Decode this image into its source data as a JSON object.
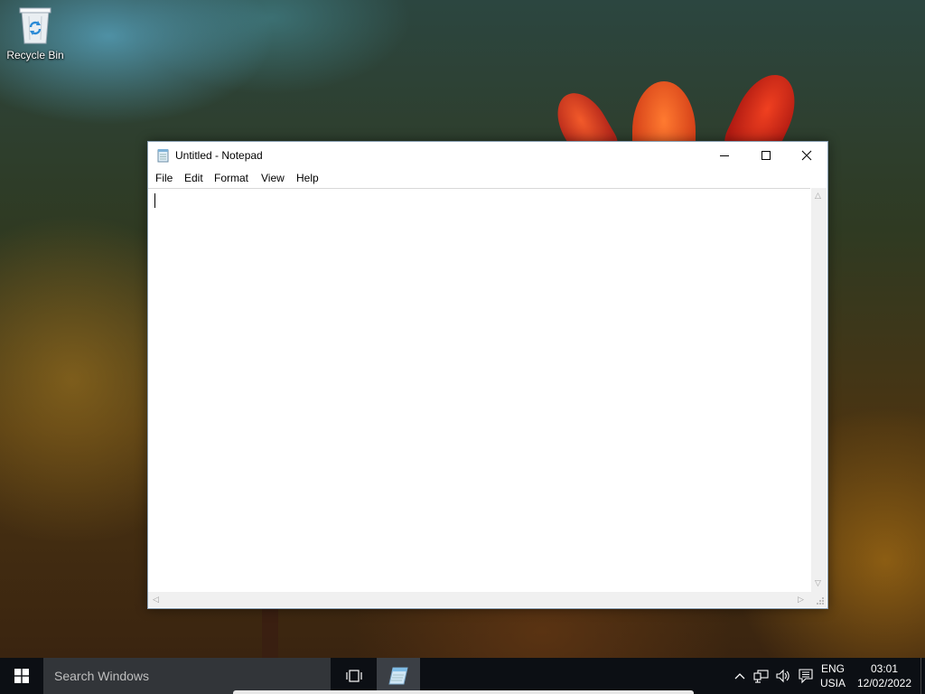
{
  "desktop": {
    "icons": [
      {
        "label": "Recycle Bin",
        "icon": "recycle-bin-icon"
      }
    ]
  },
  "window": {
    "title": "Untitled - Notepad",
    "app_icon": "notepad-icon",
    "controls": {
      "minimize": "minimize-icon",
      "maximize": "maximize-icon",
      "close": "close-icon"
    },
    "menu": [
      {
        "label": "File"
      },
      {
        "label": "Edit"
      },
      {
        "label": "Format"
      },
      {
        "label": "View"
      },
      {
        "label": "Help"
      }
    ],
    "content": ""
  },
  "taskbar": {
    "search_placeholder": "Search Windows",
    "language_line1": "ENG",
    "language_line2": "USIA",
    "time": "03:01",
    "date": "12/02/2022",
    "pinned": [
      {
        "name": "Notepad",
        "icon": "notepad-icon",
        "active": true
      }
    ]
  },
  "colors": {
    "taskbar": "#0c0f14",
    "search_box": "#323539",
    "active_indicator": "#8fb8e8"
  }
}
